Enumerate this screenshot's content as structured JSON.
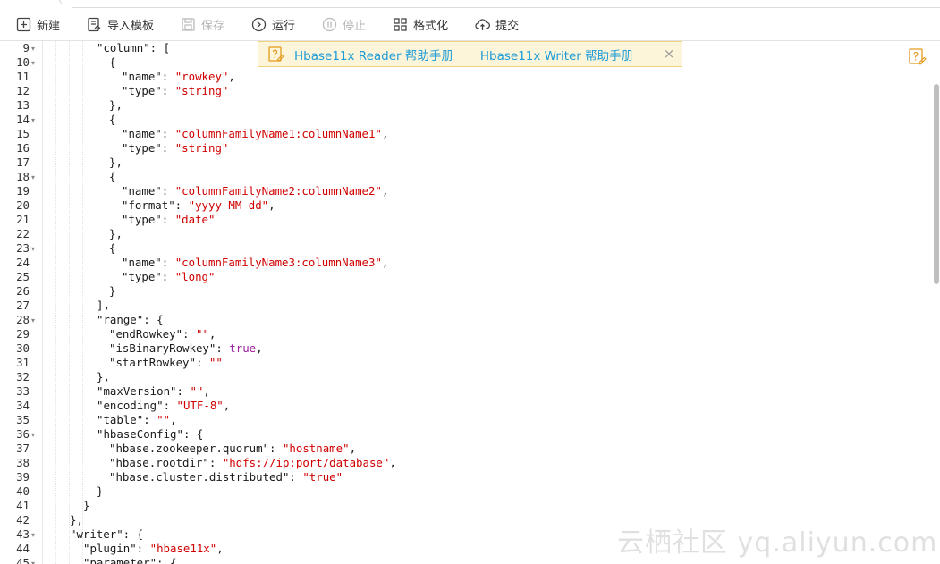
{
  "toolbar": {
    "buttons": [
      {
        "label": "新建",
        "icon": "plus-square-icon",
        "enabled": true
      },
      {
        "label": "导入模板",
        "icon": "import-template-icon",
        "enabled": true
      },
      {
        "label": "保存",
        "icon": "save-icon",
        "enabled": false
      },
      {
        "label": "运行",
        "icon": "run-icon",
        "enabled": true
      },
      {
        "label": "停止",
        "icon": "stop-icon",
        "enabled": false
      },
      {
        "label": "格式化",
        "icon": "format-grid-icon",
        "enabled": true
      },
      {
        "label": "提交",
        "icon": "upload-cloud-icon",
        "enabled": true
      }
    ]
  },
  "banner": {
    "links": [
      "Hbase11x Reader 帮助手册",
      "Hbase11x Writer 帮助手册"
    ],
    "close": "×"
  },
  "editor": {
    "lines": [
      {
        "n": "9",
        "fold": true
      },
      {
        "n": "10",
        "fold": true
      },
      {
        "n": "11",
        "fold": false
      },
      {
        "n": "12",
        "fold": false
      },
      {
        "n": "13",
        "fold": false
      },
      {
        "n": "14",
        "fold": true
      },
      {
        "n": "15",
        "fold": false
      },
      {
        "n": "16",
        "fold": false
      },
      {
        "n": "17",
        "fold": false
      },
      {
        "n": "18",
        "fold": true
      },
      {
        "n": "19",
        "fold": false
      },
      {
        "n": "20",
        "fold": false
      },
      {
        "n": "21",
        "fold": false
      },
      {
        "n": "22",
        "fold": false
      },
      {
        "n": "23",
        "fold": true
      },
      {
        "n": "24",
        "fold": false
      },
      {
        "n": "25",
        "fold": false
      },
      {
        "n": "26",
        "fold": false
      },
      {
        "n": "27",
        "fold": false
      },
      {
        "n": "28",
        "fold": true
      },
      {
        "n": "29",
        "fold": false
      },
      {
        "n": "30",
        "fold": false
      },
      {
        "n": "31",
        "fold": false
      },
      {
        "n": "32",
        "fold": false
      },
      {
        "n": "33",
        "fold": false
      },
      {
        "n": "34",
        "fold": false
      },
      {
        "n": "35",
        "fold": false
      },
      {
        "n": "36",
        "fold": true
      },
      {
        "n": "37",
        "fold": false
      },
      {
        "n": "38",
        "fold": false
      },
      {
        "n": "39",
        "fold": false
      },
      {
        "n": "40",
        "fold": false
      },
      {
        "n": "41",
        "fold": false
      },
      {
        "n": "42",
        "fold": false
      },
      {
        "n": "43",
        "fold": true
      },
      {
        "n": "44",
        "fold": false
      },
      {
        "n": "45",
        "fold": true
      }
    ],
    "code": [
      [
        {
          "t": "\"column\": ["
        }
      ],
      [
        {
          "t": "{"
        }
      ],
      [
        {
          "t": "\"name\": "
        },
        {
          "t": "\"rowkey\"",
          "c": "s"
        },
        {
          "t": ","
        }
      ],
      [
        {
          "t": "\"type\": "
        },
        {
          "t": "\"string\"",
          "c": "s"
        }
      ],
      [
        {
          "t": "},"
        }
      ],
      [
        {
          "t": "{"
        }
      ],
      [
        {
          "t": "\"name\": "
        },
        {
          "t": "\"columnFamilyName1:columnName1\"",
          "c": "s"
        },
        {
          "t": ","
        }
      ],
      [
        {
          "t": "\"type\": "
        },
        {
          "t": "\"string\"",
          "c": "s"
        }
      ],
      [
        {
          "t": "},"
        }
      ],
      [
        {
          "t": "{"
        }
      ],
      [
        {
          "t": "\"name\": "
        },
        {
          "t": "\"columnFamilyName2:columnName2\"",
          "c": "s"
        },
        {
          "t": ","
        }
      ],
      [
        {
          "t": "\"format\": "
        },
        {
          "t": "\"yyyy-MM-dd\"",
          "c": "s"
        },
        {
          "t": ","
        }
      ],
      [
        {
          "t": "\"type\": "
        },
        {
          "t": "\"date\"",
          "c": "s"
        }
      ],
      [
        {
          "t": "},"
        }
      ],
      [
        {
          "t": "{"
        }
      ],
      [
        {
          "t": "\"name\": "
        },
        {
          "t": "\"columnFamilyName3:columnName3\"",
          "c": "s"
        },
        {
          "t": ","
        }
      ],
      [
        {
          "t": "\"type\": "
        },
        {
          "t": "\"long\"",
          "c": "s"
        }
      ],
      [
        {
          "t": "}"
        }
      ],
      [
        {
          "t": "],"
        }
      ],
      [
        {
          "t": "\"range\": {"
        }
      ],
      [
        {
          "t": "\"endRowkey\": "
        },
        {
          "t": "\"\"",
          "c": "s"
        },
        {
          "t": ","
        }
      ],
      [
        {
          "t": "\"isBinaryRowkey\": "
        },
        {
          "t": "true",
          "c": "k"
        },
        {
          "t": ","
        }
      ],
      [
        {
          "t": "\"startRowkey\": "
        },
        {
          "t": "\"\"",
          "c": "s"
        }
      ],
      [
        {
          "t": "},"
        }
      ],
      [
        {
          "t": "\"maxVersion\": "
        },
        {
          "t": "\"\"",
          "c": "s"
        },
        {
          "t": ","
        }
      ],
      [
        {
          "t": "\"encoding\": "
        },
        {
          "t": "\"UTF-8\"",
          "c": "s"
        },
        {
          "t": ","
        }
      ],
      [
        {
          "t": "\"table\": "
        },
        {
          "t": "\"\"",
          "c": "s"
        },
        {
          "t": ","
        }
      ],
      [
        {
          "t": "\"hbaseConfig\": {"
        }
      ],
      [
        {
          "t": "\"hbase.zookeeper.quorum\": "
        },
        {
          "t": "\"hostname\"",
          "c": "s"
        },
        {
          "t": ","
        }
      ],
      [
        {
          "t": "\"hbase.rootdir\": "
        },
        {
          "t": "\"hdfs://ip:port/database\"",
          "c": "s"
        },
        {
          "t": ","
        }
      ],
      [
        {
          "t": "\"hbase.cluster.distributed\": "
        },
        {
          "t": "\"true\"",
          "c": "s"
        }
      ],
      [
        {
          "t": "}"
        }
      ],
      [
        {
          "t": "}"
        }
      ],
      [
        {
          "t": "},"
        }
      ],
      [
        {
          "t": "\"writer\": {"
        }
      ],
      [
        {
          "t": "\"plugin\": "
        },
        {
          "t": "\"hbase11x\"",
          "c": "s"
        },
        {
          "t": ","
        }
      ],
      [
        {
          "t": "\"parameter\": {"
        }
      ]
    ]
  },
  "watermark": "云栖社区 yq.aliyun.com",
  "colors": {
    "string": "#d00000",
    "keyword": "#a020a0",
    "link": "#1c9bd8",
    "banner_bg": "#fdf5d9",
    "banner_border": "#f2d27a"
  }
}
